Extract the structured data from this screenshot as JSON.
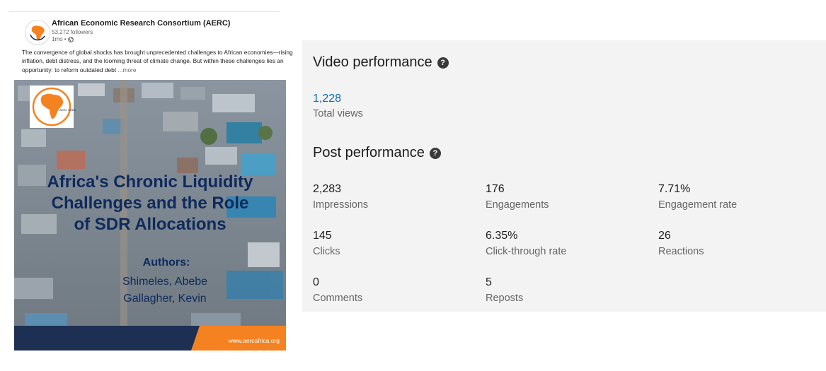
{
  "post": {
    "org_name": "African Economic Research Consortium (AERC)",
    "followers": "53,272 followers",
    "time": "1mo •",
    "text": "The convergence of global shocks has brought unprecedented challenges to African economies—rising inflation, debt distress, and the looming threat of climate change. But within these challenges lies an opportunity: to reform outdated debt",
    "see_more": "...more",
    "image": {
      "logo_text": "AERC CREA",
      "title_line1": "Africa's Chronic Liquidity",
      "title_line2": "Challenges and the Role",
      "title_line3": "of SDR Allocations",
      "authors_label": "Authors:",
      "author1": "Shimeles, Abebe",
      "author2": "Gallagher, Kevin",
      "url": "www.aercafrica.org"
    }
  },
  "video": {
    "heading": "Video performance",
    "total_views_value": "1,228",
    "total_views_label": "Total views"
  },
  "performance": {
    "heading": "Post performance",
    "metrics": [
      {
        "value": "2,283",
        "label": "Impressions"
      },
      {
        "value": "176",
        "label": "Engagements"
      },
      {
        "value": "7.71%",
        "label": "Engagement rate"
      },
      {
        "value": "145",
        "label": "Clicks"
      },
      {
        "value": "6.35%",
        "label": "Click-through rate"
      },
      {
        "value": "26",
        "label": "Reactions"
      },
      {
        "value": "0",
        "label": "Comments"
      },
      {
        "value": "5",
        "label": "Reposts"
      }
    ]
  },
  "colors": {
    "accent_blue": "#0a66c2",
    "brand_orange": "#f58220",
    "title_navy": "#0f2a5c"
  }
}
